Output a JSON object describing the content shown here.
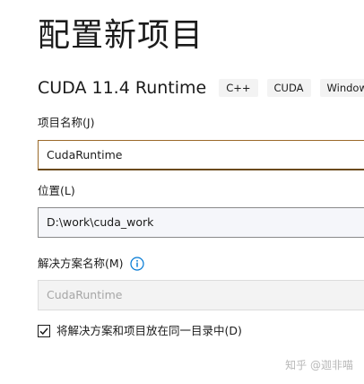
{
  "page": {
    "title": "配置新项目"
  },
  "template": {
    "name": "CUDA 11.4 Runtime",
    "tags": [
      "C++",
      "CUDA",
      "Windows"
    ]
  },
  "project_name": {
    "label": "项目名称(J)",
    "value": "CudaRuntime"
  },
  "location": {
    "label": "位置(L)",
    "value": "D:\\work\\cuda_work"
  },
  "solution_name": {
    "label": "解决方案名称(M)",
    "value": "CudaRuntime",
    "info_icon": "info-icon"
  },
  "same_directory": {
    "label": "将解决方案和项目放在同一目录中(D)",
    "checked": true
  },
  "watermark": {
    "text": "知乎 @迦非喵"
  },
  "colors": {
    "accent": "#0078d4",
    "active_border": "#9b6a2a"
  }
}
